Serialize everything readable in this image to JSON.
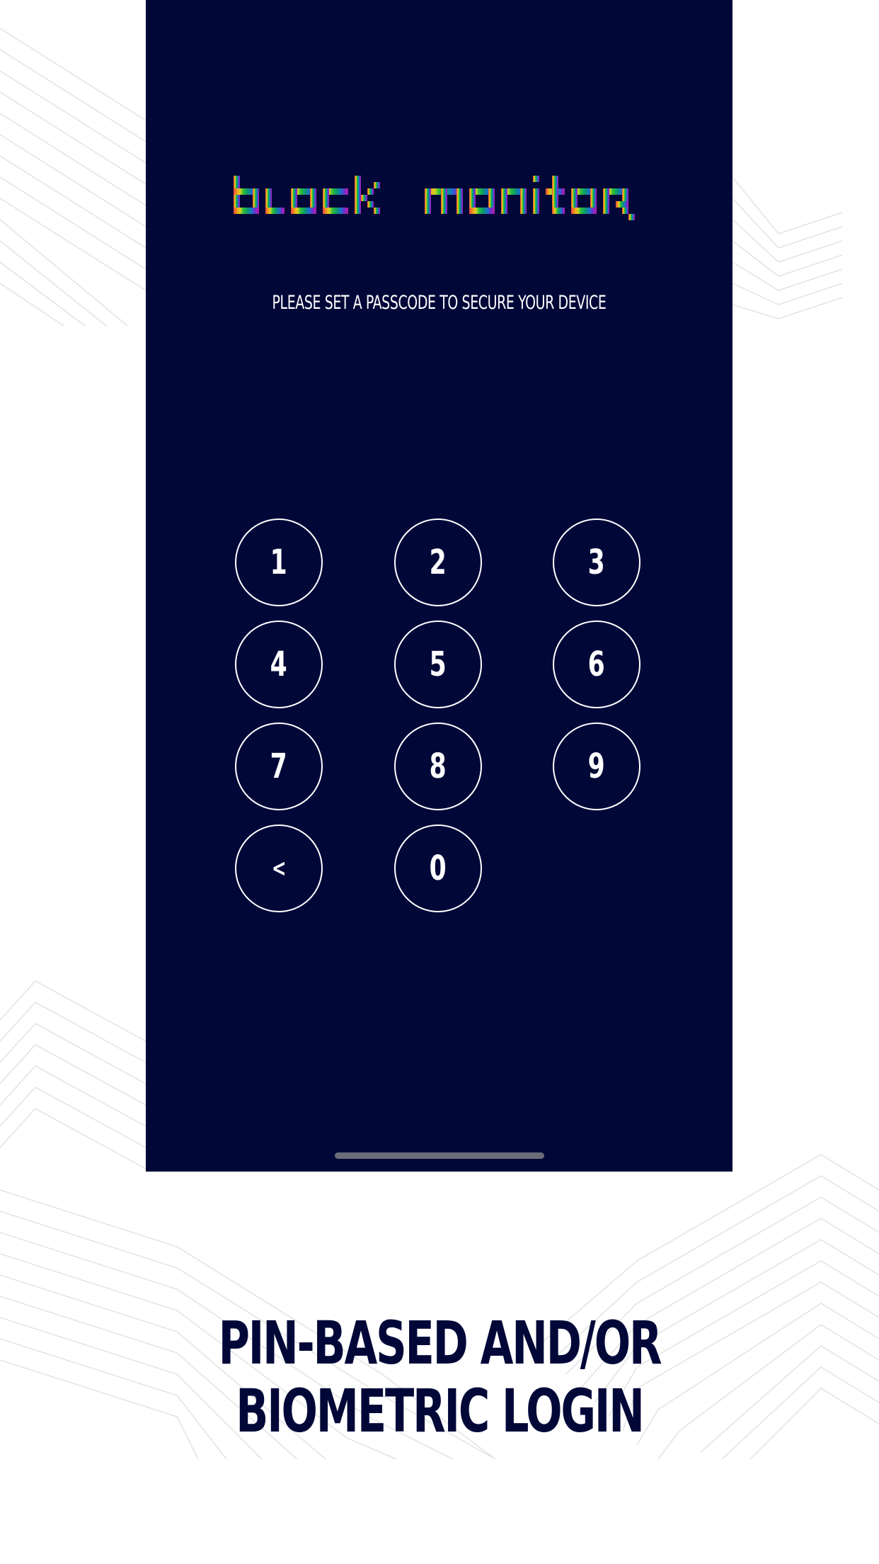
{
  "app": {
    "logo_text": "block monitor"
  },
  "lock_screen": {
    "prompt": "PLEASE SET A PASSCODE TO SECURE YOUR DEVICE",
    "keypad": {
      "k1": "1",
      "k2": "2",
      "k3": "3",
      "k4": "4",
      "k5": "5",
      "k6": "6",
      "k7": "7",
      "k8": "8",
      "k9": "9",
      "back": "<",
      "k0": "0"
    }
  },
  "caption": {
    "line1": "PIN-BASED AND/OR",
    "line2": "BIOMETRIC LOGIN"
  },
  "colors": {
    "screen_bg": "#010838",
    "caption_text": "#010838",
    "logo_gradient": [
      "#e8473a",
      "#f39a1f",
      "#d9d21f",
      "#2fbf3a",
      "#0b9a6e",
      "#1b6fd0",
      "#7a2bc9",
      "#b21fa8"
    ]
  }
}
